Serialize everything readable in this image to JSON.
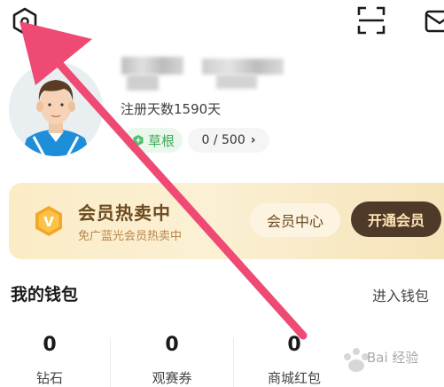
{
  "topbar": {
    "settings_icon": "hexagon-gear-icon",
    "scan_icon": "scan-icon",
    "mail_icon": "mail-icon"
  },
  "profile": {
    "registration_text": "注册天数1590天",
    "level_label": "草根",
    "level_icon": "leaf-icon",
    "exp_text": "0 / 500",
    "exp_chevron": "›",
    "level_color": "#3fa757"
  },
  "vip": {
    "badge_letter": "V",
    "title": "会员热卖中",
    "subtitle": "免广蓝光会员热卖中",
    "center_button": "会员中心",
    "open_button": "开通会员",
    "accent": "#4f3a2a",
    "title_color": "#6b4a1f"
  },
  "wallet": {
    "title": "我的钱包",
    "link": "进入钱包",
    "stats": [
      {
        "value": "0",
        "label": "钻石"
      },
      {
        "value": "0",
        "label": "观赛券"
      },
      {
        "value": "0",
        "label": "商城红包"
      }
    ]
  },
  "annotation": {
    "arrow_color": "#ee4a74"
  },
  "watermark": {
    "text": "Bai 经验"
  }
}
